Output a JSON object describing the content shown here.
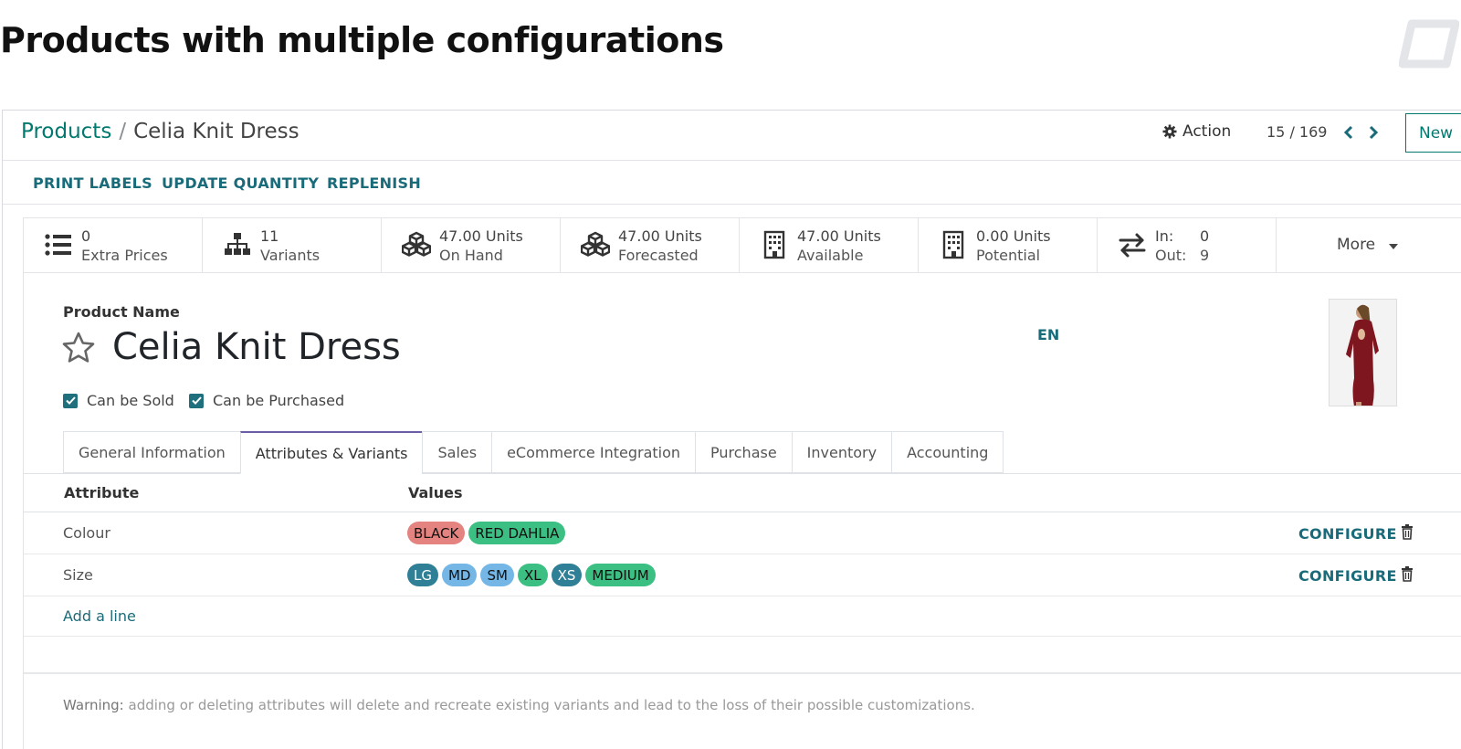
{
  "slide": {
    "title": "Products with multiple configurations"
  },
  "breadcrumb": {
    "parent": "Products",
    "separator": "/",
    "current": "Celia Knit Dress"
  },
  "control_panel": {
    "action_label": "Action",
    "pager": "15 / 169",
    "new_label": "New"
  },
  "status_actions": [
    "PRINT LABELS",
    "UPDATE QUANTITY",
    "REPLENISH"
  ],
  "stats": [
    {
      "icon": "list-icon",
      "value": "0",
      "label": "Extra Prices"
    },
    {
      "icon": "sitemap-icon",
      "value": "11",
      "label": "Variants"
    },
    {
      "icon": "cubes-icon",
      "value": "47.00 Units",
      "label": "On Hand"
    },
    {
      "icon": "cubes-icon",
      "value": "47.00 Units",
      "label": "Forecasted"
    },
    {
      "icon": "building-icon",
      "value": "47.00 Units",
      "label": "Available"
    },
    {
      "icon": "building-icon",
      "value": "0.00 Units",
      "label": "Potential"
    },
    {
      "icon": "exchange-icon",
      "in_label": "In:",
      "in_value": "0",
      "out_label": "Out:",
      "out_value": "9"
    }
  ],
  "more_label": "More",
  "form": {
    "product_name_label": "Product Name",
    "product_name": "Celia Knit Dress",
    "lang": "EN",
    "can_be_sold": "Can be Sold",
    "can_be_purchased": "Can be Purchased"
  },
  "tabs": [
    "General Information",
    "Attributes & Variants",
    "Sales",
    "eCommerce Integration",
    "Purchase",
    "Inventory",
    "Accounting"
  ],
  "active_tab": "Attributes & Variants",
  "grid": {
    "headers": {
      "attribute": "Attribute",
      "values": "Values"
    },
    "rows": [
      {
        "attribute": "Colour",
        "values": [
          {
            "label": "BLACK",
            "color": "#e4837f"
          },
          {
            "label": "RED DAHLIA",
            "color": "#3cbf82"
          }
        ]
      },
      {
        "attribute": "Size",
        "values": [
          {
            "label": "LG",
            "color": "#2f7f97",
            "text": "#ffffff"
          },
          {
            "label": "MD",
            "color": "#74b7e6"
          },
          {
            "label": "SM",
            "color": "#74b7e6"
          },
          {
            "label": "XL",
            "color": "#3cbf82"
          },
          {
            "label": "XS",
            "color": "#2f7f97",
            "text": "#ffffff"
          },
          {
            "label": "MEDIUM",
            "color": "#3cbf82"
          }
        ]
      }
    ],
    "configure_label": "CONFIGURE",
    "add_line": "Add a line"
  },
  "warning": {
    "strong": "Warning:",
    "text": " adding or deleting attributes will delete and recreate existing variants and lead to the loss of their possible customizations."
  },
  "colors": {
    "accent": "#01796f",
    "link": "#1a6b7a",
    "checkbox": "#1f6f7d",
    "active_tab": "#6b5ea6"
  }
}
